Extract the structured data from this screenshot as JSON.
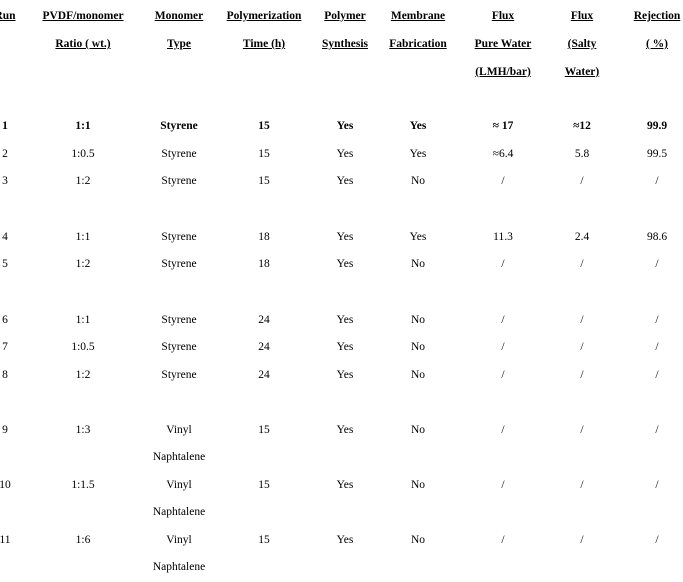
{
  "table": {
    "headers": [
      [
        "Run"
      ],
      [
        "PVDF/monomer",
        "Ratio ( wt.)"
      ],
      [
        "Monomer",
        "Type"
      ],
      [
        "Polymerization",
        "Time (h)"
      ],
      [
        "Polymer",
        "Synthesis"
      ],
      [
        "Membrane",
        "Fabrication"
      ],
      [
        "Flux",
        "Pure Water",
        "(LMH/bar)"
      ],
      [
        "Flux",
        "(Salty",
        "Water)"
      ],
      [
        "Rejection",
        "( %)"
      ]
    ],
    "rows": [
      {
        "bold": true,
        "cells": [
          "1",
          "1:1",
          "Styrene",
          "15",
          "Yes",
          "Yes",
          "≈ 17",
          "≈12",
          "99.9"
        ]
      },
      {
        "bold": false,
        "cells": [
          "2",
          "1:0.5",
          "Styrene",
          "15",
          "Yes",
          "Yes",
          "≈6.4",
          "5.8",
          "99.5"
        ]
      },
      {
        "bold": false,
        "cells": [
          "3",
          "1:2",
          "Styrene",
          "15",
          "Yes",
          "No",
          "/",
          "/",
          "/"
        ]
      },
      {
        "bold": false,
        "cells": [
          "4",
          "1:1",
          "Styrene",
          "18",
          "Yes",
          "Yes",
          "11.3",
          "2.4",
          "98.6"
        ]
      },
      {
        "bold": false,
        "cells": [
          "5",
          "1:2",
          "Styrene",
          "18",
          "Yes",
          "No",
          "/",
          "/",
          "/"
        ]
      },
      {
        "bold": false,
        "cells": [
          "6",
          "1:1",
          "Styrene",
          "24",
          "Yes",
          "No",
          "/",
          "/",
          "/"
        ]
      },
      {
        "bold": false,
        "cells": [
          "7",
          "1:0.5",
          "Styrene",
          "24",
          "Yes",
          "No",
          "/",
          "/",
          "/"
        ]
      },
      {
        "bold": false,
        "cells": [
          "8",
          "1:2",
          "Styrene",
          "24",
          "Yes",
          "No",
          "/",
          "/",
          "/"
        ]
      },
      {
        "bold": false,
        "cells": [
          "9",
          "1:3",
          "Vinyl\nNaphtalene",
          "15",
          "Yes",
          "No",
          "/",
          "/",
          "/"
        ]
      },
      {
        "bold": false,
        "cells": [
          "10",
          "1:1.5",
          "Vinyl\nNaphtalene",
          "15",
          "Yes",
          "No",
          "/",
          "/",
          "/"
        ]
      },
      {
        "bold": false,
        "cells": [
          "11",
          "1:6",
          "Vinyl\nNaphtalene",
          "15",
          "Yes",
          "No",
          "/",
          "/",
          "/"
        ]
      }
    ]
  }
}
